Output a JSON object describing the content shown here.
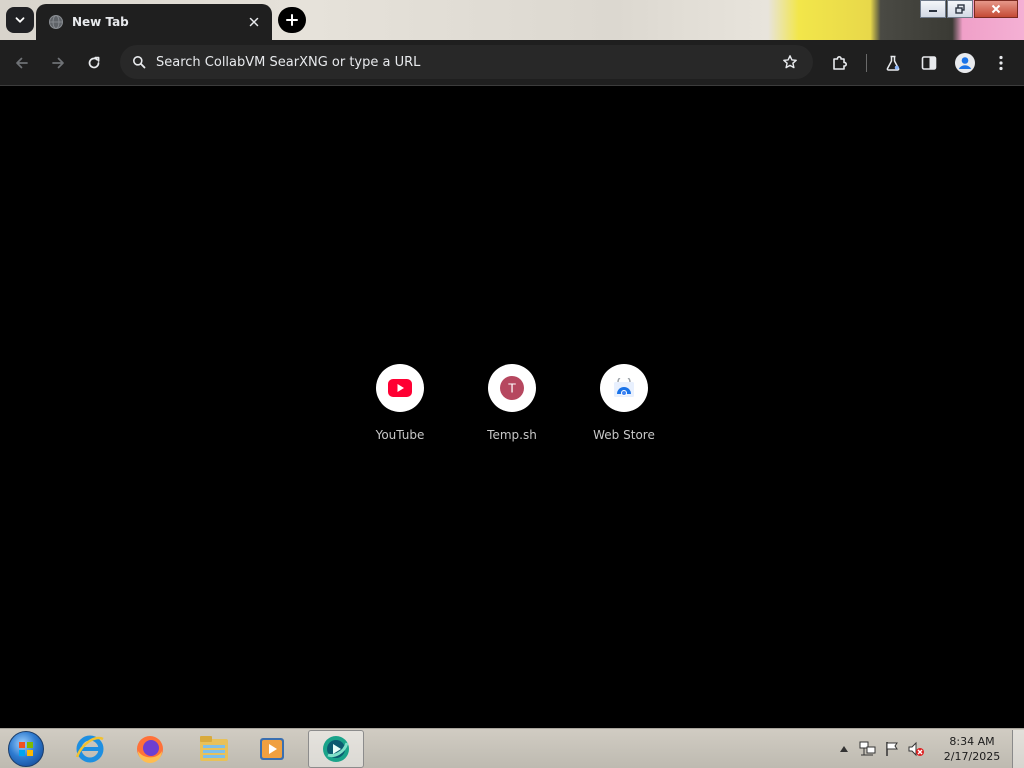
{
  "browser": {
    "tab": {
      "title": "New Tab",
      "icon": "globe-icon"
    },
    "omnibox": {
      "placeholder": "Search CollabVM SearXNG or type a URL"
    },
    "toolbar_icons": [
      "back-arrow-icon",
      "forward-arrow-icon",
      "reload-icon",
      "bookmark-star-icon",
      "extensions-puzzle-icon",
      "labs-flask-icon",
      "side-panel-icon",
      "profile-icon",
      "kebab-menu-icon"
    ]
  },
  "shortcuts": [
    {
      "label": "YouTube",
      "icon": "youtube-icon",
      "color": "#ff0033"
    },
    {
      "label": "Temp.sh",
      "icon": "letter-avatar-icon",
      "letter": "T",
      "color": "#b6475f"
    },
    {
      "label": "Web Store",
      "icon": "web-store-icon",
      "color": "#1a73e8"
    }
  ],
  "taskbar": {
    "apps": [
      "windows-start-orb-icon",
      "internet-explorer-icon",
      "firefox-icon",
      "file-explorer-icon",
      "media-player-icon",
      "browser-app-icon"
    ],
    "clock": {
      "time": "8:34 AM",
      "date": "2/17/2025"
    }
  },
  "colors": {
    "chrome_bg": "#1f1f1f",
    "omnibox_bg": "#282828",
    "page_bg": "#000000",
    "text_light": "#e8eaed"
  }
}
